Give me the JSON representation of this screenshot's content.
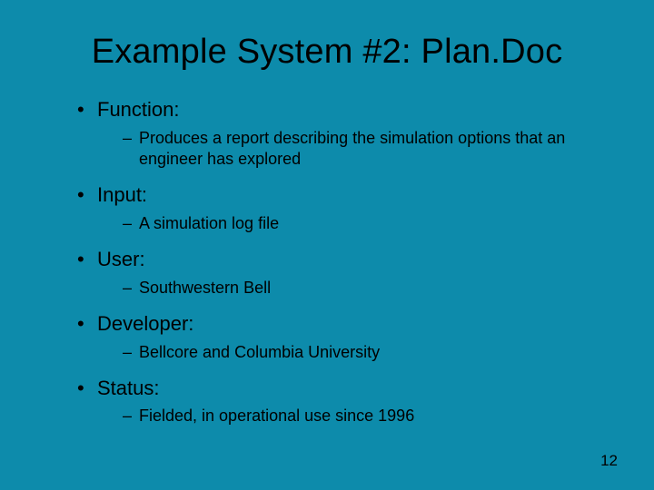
{
  "title": "Example System #2: Plan.Doc",
  "bullets": [
    {
      "label": "Function:",
      "sub": [
        "Produces a report describing the simulation options that an engineer has explored"
      ]
    },
    {
      "label": "Input:",
      "sub": [
        "A simulation log file"
      ]
    },
    {
      "label": "User:",
      "sub": [
        "Southwestern Bell"
      ]
    },
    {
      "label": "Developer:",
      "sub": [
        "Bellcore and Columbia University"
      ]
    },
    {
      "label": "Status:",
      "sub": [
        "Fielded, in operational use since 1996"
      ]
    }
  ],
  "page_number": "12"
}
